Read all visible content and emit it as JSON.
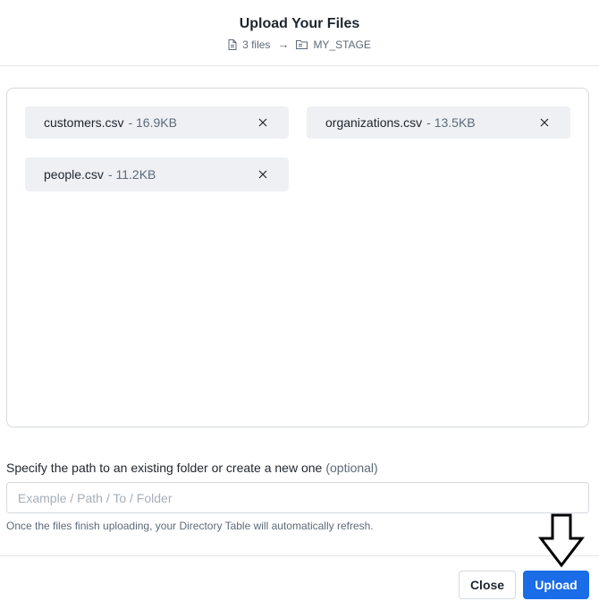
{
  "dialog": {
    "title": "Upload Your Files",
    "summary": {
      "file_icon": "file-icon",
      "files_count_label": "3 files",
      "arrow_icon": "arrow-right-icon",
      "arrow_glyph": "→",
      "stage_icon": "folder-stage-icon",
      "stage_name": "MY_STAGE"
    }
  },
  "files": [
    {
      "name": "customers.csv",
      "size": "- 16.9KB",
      "remove_icon": "close-icon"
    },
    {
      "name": "organizations.csv",
      "size": "- 13.5KB",
      "remove_icon": "close-icon"
    },
    {
      "name": "people.csv",
      "size": "- 11.2KB",
      "remove_icon": "close-icon"
    }
  ],
  "path": {
    "label": "Specify the path to an existing folder or create a new one",
    "optional_label": "(optional)",
    "placeholder": "Example / Path / To / Folder",
    "value": "",
    "helper_text": "Once the files finish uploading, your Directory Table will automatically refresh."
  },
  "footer": {
    "close_label": "Close",
    "upload_label": "Upload",
    "annotation_icon": "down-arrow-outline-icon"
  },
  "colors": {
    "primary": "#1a6ce7",
    "chip_bg": "#eef0f3",
    "muted_text": "#5d6a78",
    "border": "#d5d9de"
  }
}
